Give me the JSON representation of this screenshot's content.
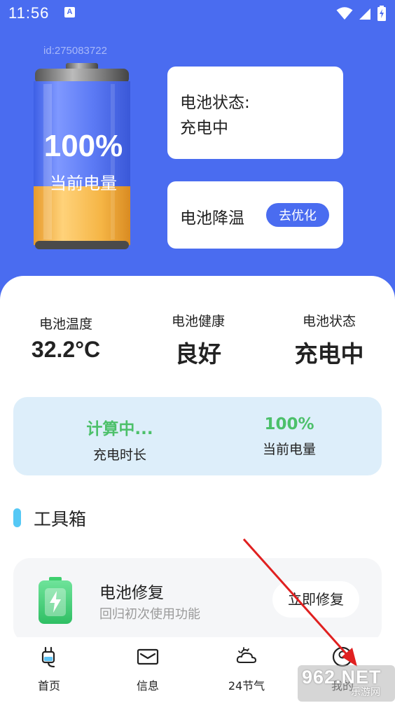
{
  "status_bar": {
    "time": "11:56",
    "notification_letter": "A"
  },
  "header": {
    "user_id": "id:275083722",
    "battery_percent": "100%",
    "battery_caption": "当前电量",
    "status_card": {
      "line1": "电池状态:",
      "line2": "充电中"
    },
    "cooling_card": {
      "label": "电池降温",
      "button_label": "去优化"
    }
  },
  "stats": {
    "temperature": {
      "label": "电池温度",
      "value": "32.2°C"
    },
    "health": {
      "label": "电池健康",
      "value": "良好"
    },
    "state": {
      "label": "电池状态",
      "value": "充电中"
    }
  },
  "charge_info": {
    "charge_time": {
      "value": "计算中...",
      "label": "充电时长"
    },
    "current_level": {
      "value": "100%",
      "label": "当前电量"
    },
    "accent_color": "#4cc06a"
  },
  "toolbox": {
    "title": "工具箱",
    "tools": [
      {
        "title": "电池修复",
        "subtitle": "回归初次使用功能",
        "button_label": "立即修复",
        "icon": "battery-charging-icon"
      }
    ]
  },
  "bottom_nav": {
    "items": [
      {
        "label": "首页",
        "icon": "charger-plug-icon"
      },
      {
        "label": "信息",
        "icon": "envelope-icon"
      },
      {
        "label": "24节气",
        "icon": "weather-cloud-icon"
      },
      {
        "label": "我的",
        "icon": "user-icon"
      }
    ]
  },
  "watermark": {
    "text": "962.NET",
    "subtext": "乐游网"
  },
  "colors": {
    "primary": "#4a6cf0",
    "panel_bg": "#ddeefa",
    "tool_green": "#3ecf6e",
    "battery_fill": "#f5b545"
  }
}
